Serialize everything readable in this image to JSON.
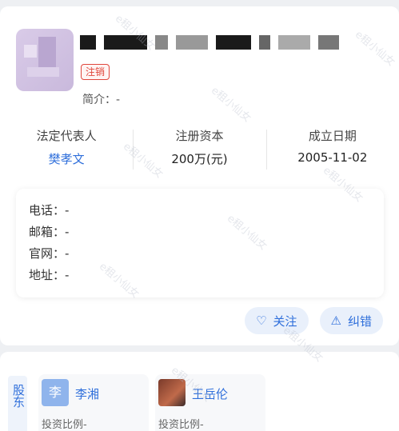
{
  "company": {
    "status_badge": "注销",
    "intro": "简介：-"
  },
  "stats": [
    {
      "label": "法定代表人",
      "value": "樊孝文"
    },
    {
      "label": "注册资本",
      "value": "200万(元)"
    },
    {
      "label": "成立日期",
      "value": "2005-11-02"
    }
  ],
  "contact": {
    "phone": "电话：-",
    "email": "邮箱：-",
    "website": "官网：-",
    "address": "地址：-"
  },
  "actions": {
    "follow_label": "关注",
    "correct_label": "纠错"
  },
  "shareholders": {
    "tab_label": "股东",
    "tab_label2": "东",
    "items": [
      {
        "avatar_text": "李",
        "name": "李湘",
        "ratio": "投资比例-"
      },
      {
        "avatar_text": "",
        "name": "王岳伦",
        "ratio": "投资比例-"
      }
    ]
  },
  "watermark": "e租小仙女",
  "colors": {
    "accent": "#2f6fdb",
    "badge": "#e0473c"
  }
}
